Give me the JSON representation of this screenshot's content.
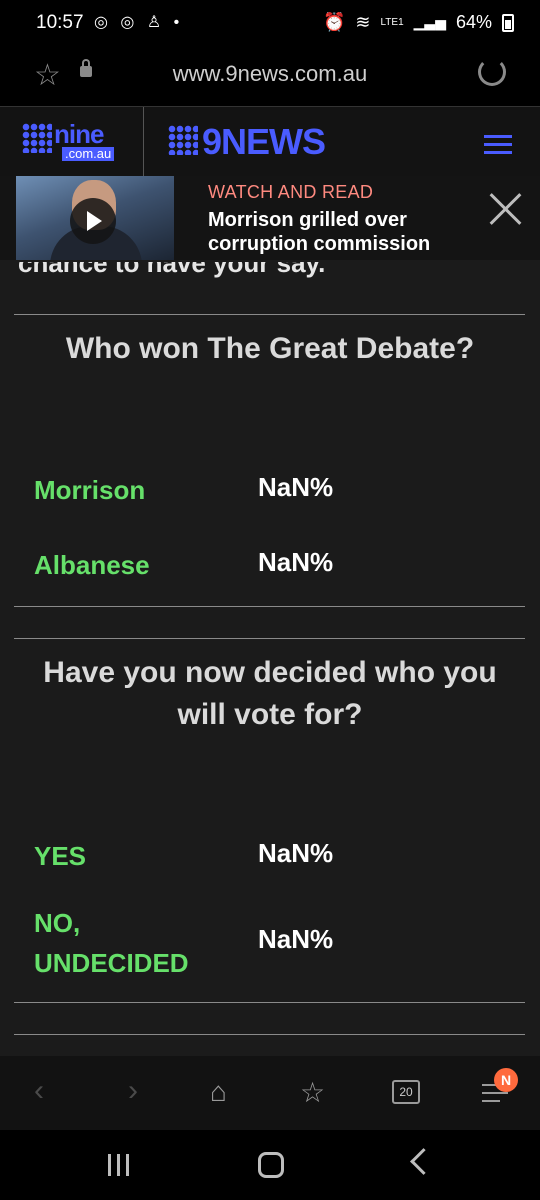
{
  "status_bar": {
    "time": "10:57",
    "left_icons": [
      "instagram-icon",
      "instagram-icon",
      "accessibility-icon",
      "dot-icon"
    ],
    "network": "LTE1",
    "battery": "64%"
  },
  "browser": {
    "url": "www.9news.com.au"
  },
  "site": {
    "nine_logo": "nine",
    "nine_sub": ".com.au",
    "news_logo": "9NEWS",
    "accent": "#4a5cff"
  },
  "banner": {
    "kicker": "WATCH AND READ",
    "title": "Morrison grilled over corruption commission"
  },
  "content": {
    "clipped_text": "chance to have your say.",
    "polls": [
      {
        "question": "Who won The Great Debate?",
        "options": [
          {
            "label": "Morrison",
            "value": "NaN%"
          },
          {
            "label": "Albanese",
            "value": "NaN%"
          }
        ]
      },
      {
        "question": "Have you now decided who you will vote for?",
        "options": [
          {
            "label": "YES",
            "value": "NaN%"
          },
          {
            "label": "NO, UNDECIDED",
            "value": "NaN%"
          }
        ]
      }
    ],
    "option_color": "#66e06a"
  },
  "bottom_nav": {
    "tab_count": "20",
    "badge": "N"
  }
}
